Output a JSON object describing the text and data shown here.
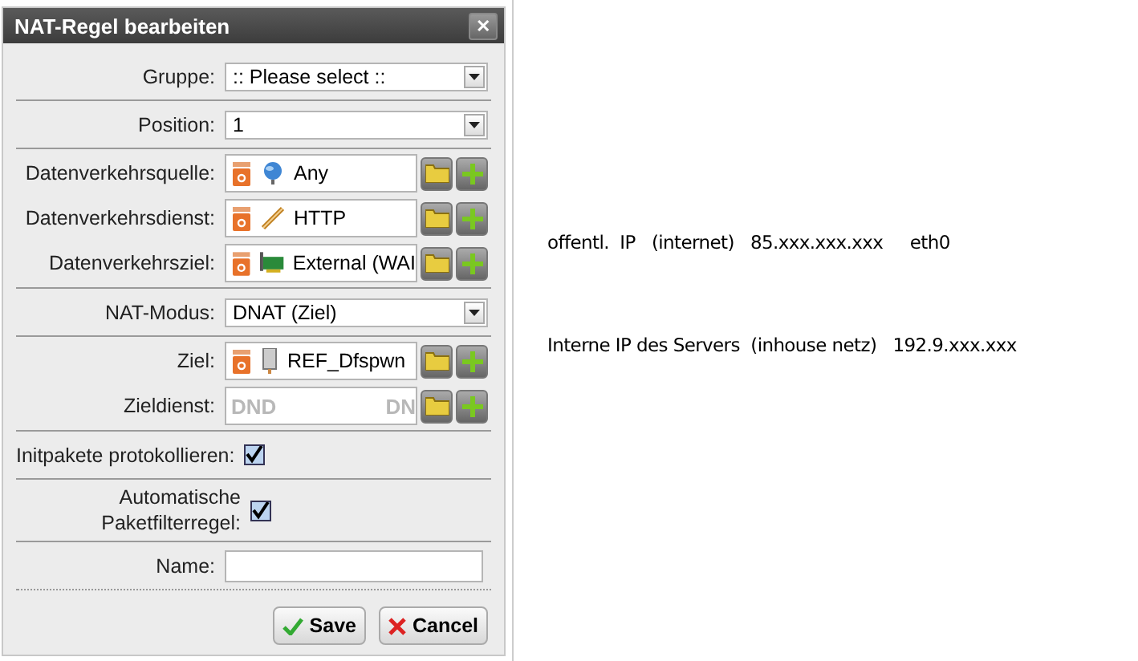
{
  "dialog": {
    "title": "NAT-Regel bearbeiten",
    "close": "✕",
    "groups": [
      {
        "fields": [
          {
            "kind": "select",
            "label": "Gruppe:",
            "value": ":: Please select ::"
          }
        ]
      },
      {
        "fields": [
          {
            "kind": "select",
            "label": "Position:",
            "value": "1"
          }
        ]
      },
      {
        "fields": [
          {
            "kind": "object",
            "label": "Datenverkehrsquelle:",
            "value": "Any"
          },
          {
            "kind": "object",
            "label": "Datenverkehrsdienst:",
            "value": "HTTP"
          },
          {
            "kind": "object",
            "label": "Datenverkehrsziel:",
            "value": "External (WAI"
          }
        ]
      },
      {
        "fields": [
          {
            "kind": "select",
            "label": "NAT-Modus:",
            "value": "DNAT (Ziel)"
          }
        ]
      },
      {
        "fields": [
          {
            "kind": "object",
            "label": "Ziel:",
            "value": "REF_Dfspwn"
          },
          {
            "kind": "empty-object",
            "label": "Zieldienst:",
            "placeholder": [
              "DND",
              "DN"
            ]
          }
        ]
      },
      {
        "fields": [
          {
            "kind": "checkbox",
            "label": "Initpakete protokollieren:",
            "checked": true
          }
        ]
      },
      {
        "fields": [
          {
            "kind": "checkbox",
            "label": "Automatische Paketfilterregel:",
            "checked": true
          }
        ]
      },
      {
        "fields": [
          {
            "kind": "text",
            "label": "Name:"
          }
        ]
      }
    ],
    "buttons": [
      {
        "kind": "save",
        "label": "Save"
      },
      {
        "kind": "cancel",
        "label": "Cancel"
      }
    ]
  },
  "notes": [
    "offentl.  IP   (internet)   85.xxx.xxx.xxx     eth0",
    "Interne IP des Servers  (inhouse netz)   192.9.xxx.xxx"
  ]
}
